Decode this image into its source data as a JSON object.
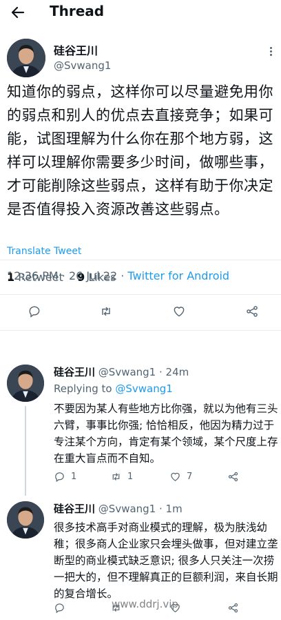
{
  "header": {
    "title": "Thread",
    "back_icon": "arrow-left-icon"
  },
  "tweet": {
    "author_name": "硅谷王川",
    "author_handle": "@Svwang1",
    "text": "知道你的弱点，这样你可以尽量避免用你的弱点和别人的优点去直接竞争；如果可能，试图理解为什么你在那个地方弱，这样可以理解你需要多少时间，做哪些事，才可能削除这些弱点，这样有助于你决定是否值得投入资源改善这些弱点。",
    "translate_label": "Translate Tweet",
    "time": "12:36 PM",
    "date": "26 Jul 22",
    "separator": "·",
    "source": "Twitter for Android",
    "retweet_count": "1",
    "retweet_label": "Retweet",
    "likes_count": "9",
    "likes_label": "Likes"
  },
  "replies": [
    {
      "author_name": "硅谷王川",
      "author_handle": "@Svwang1",
      "age": "· 24m",
      "replying_label": "Replying to",
      "replying_to": "@Svwang1",
      "text": "不要因为某人有些地方比你强，就以为他有三头六臂，事事比你强; 恰恰相反，他因为精力过于专注某个方向，肯定有某个领域，某个尺度上存在重大盲点而不自知。",
      "reply_count": "1",
      "retweet_count": "1",
      "like_count": "7"
    },
    {
      "author_name": "硅谷王川",
      "author_handle": "@Svwang1",
      "age": "· 1m",
      "text": "很多技术高手对商业模式的理解，极为肤浅幼稚；很多商人企业家只会埋头做事，但对建立垄断型的商业模式缺乏意识; 很多人只关注一次捞一把大的，但不理解真正的巨额利润，来自长期的复合增长。"
    }
  ],
  "watermark": "www.ddrj.vip",
  "colors": {
    "accent": "#1d9bf0",
    "secondary_text": "#536471",
    "divider": "#e6ecf0"
  }
}
